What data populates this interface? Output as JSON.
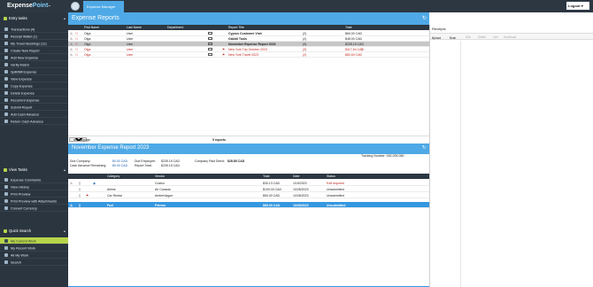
{
  "app": {
    "logo_text_a": "Expense",
    "logo_text_b": "Point",
    "logo_mark": "™",
    "active_tab": "Expense Manager",
    "logout_label": "Logout",
    "logout_chevron": "▾",
    "accent": "#4fa9e6",
    "sidebar_bg": "#2a3540",
    "highlight": "#b8d44a"
  },
  "sidebar": {
    "entry_tasks": {
      "title": "Entry tasks",
      "items": [
        {
          "label": "Transactions (4)"
        },
        {
          "label": "Receipt Wallet (1)"
        },
        {
          "label": "My Travel Bookings (11)"
        },
        {
          "label": "Create New Report"
        },
        {
          "label": "Add New Expense"
        },
        {
          "label": "Verify Match"
        },
        {
          "label": "Split/Bill Expense"
        },
        {
          "label": "View Expense"
        },
        {
          "label": "Copy Expense"
        },
        {
          "label": "Delete Expense"
        },
        {
          "label": "Recurrent Expense"
        },
        {
          "label": "Submit Report"
        },
        {
          "label": "Add Cash Advance"
        },
        {
          "label": "Return Cash Advance"
        }
      ]
    },
    "view_tasks": {
      "title": "View Tasks",
      "items": [
        {
          "label": "Expense Comments"
        },
        {
          "label": "View History"
        },
        {
          "label": "Print Preview"
        },
        {
          "label": "Print Preview with Attachments"
        },
        {
          "label": "Convert Currency"
        }
      ]
    },
    "quick_search": {
      "title": "Quick Search",
      "items": [
        {
          "label": "My Current Work"
        },
        {
          "label": "My Recent Work"
        },
        {
          "label": "All My Work"
        },
        {
          "label": "Search"
        }
      ]
    }
  },
  "reports": {
    "title": "Expense Reports",
    "refresh_glyph": "↻",
    "columns": [
      "First Name",
      "Last Name",
      "Department",
      "Report Title",
      "Total"
    ],
    "rows": [
      {
        "first": "Olga",
        "last": "User",
        "title": "Cyprus Customer Visit",
        "count": "(2)",
        "total": "$60.00 CAD",
        "red": false,
        "selected": false,
        "flag": false
      },
      {
        "first": "Olga",
        "last": "User",
        "title": "Gabidi Tools",
        "count": "(2)",
        "total": "$45.00 CAD",
        "red": false,
        "selected": false,
        "flag": false
      },
      {
        "first": "Olga",
        "last": "User",
        "title": "November Expense Report 2023",
        "count": "(4)",
        "total": "$235.15 CAD",
        "red": false,
        "selected": true,
        "flag": false
      },
      {
        "first": "Olga",
        "last": "User",
        "title": "New York Trip October 2023",
        "count": "(3)",
        "total": "$417.64 CAD",
        "red": true,
        "selected": false,
        "flag": true
      },
      {
        "first": "Olga",
        "last": "User",
        "title": "New York Travel 2023",
        "count": "(2)",
        "total": "$80.69 CAD",
        "red": true,
        "selected": false,
        "flag": true
      }
    ],
    "pager_value": "50",
    "pager_label": "results/page",
    "count_label": "5 reports"
  },
  "detail": {
    "title": "November Expense Report 2023",
    "refresh_glyph": "↻",
    "tracking": "Tracking Number: 000-009-060",
    "due_company_label": "Due Company:",
    "due_company_value": "$0.00 CAD",
    "cash_adv_label": "Cash Advance Remaining:",
    "cash_adv_value": "$0.00 CAD",
    "due_employee_label": "Due Employee:",
    "due_employee_value": "$235.15 CAD",
    "report_total_label": "Report Total:",
    "report_total_value": "$235.15 CAD",
    "company_paid_label": "Company Paid Direct:",
    "company_paid_value": "$28.85 CAD",
    "columns": [
      "Category",
      "Vendor",
      "Total",
      "Date",
      "Status"
    ],
    "rows": [
      {
        "category": "",
        "vendor": "Costco",
        "total": "$30.13 CAD",
        "date": "1/15/2023",
        "status": "Edit required",
        "status_red": true
      },
      {
        "category": "Airline",
        "vendor": "Air Canada",
        "total": "$100.00 CAD",
        "date": "10/28/2023",
        "status": "Unsubmitted",
        "status_red": false
      },
      {
        "category": "Car Rental",
        "vendor": "AmberVague",
        "total": "$50.00 CAD",
        "date": "10/28/2023",
        "status": "Unsubmitted",
        "status_red": false
      },
      {
        "category": "Fuel",
        "vendor": "Petrom",
        "total": "$65.00 CAD",
        "date": "10/28/2023",
        "status": "Unsubmitted",
        "status_red": false
      }
    ]
  },
  "receipts": {
    "title": "Receipts",
    "toolbar": [
      "Upload",
      "Scan",
      "Edit",
      "Delete",
      "Link",
      "Download"
    ],
    "upload_glyph": "⤒",
    "scan_glyph": "+"
  }
}
